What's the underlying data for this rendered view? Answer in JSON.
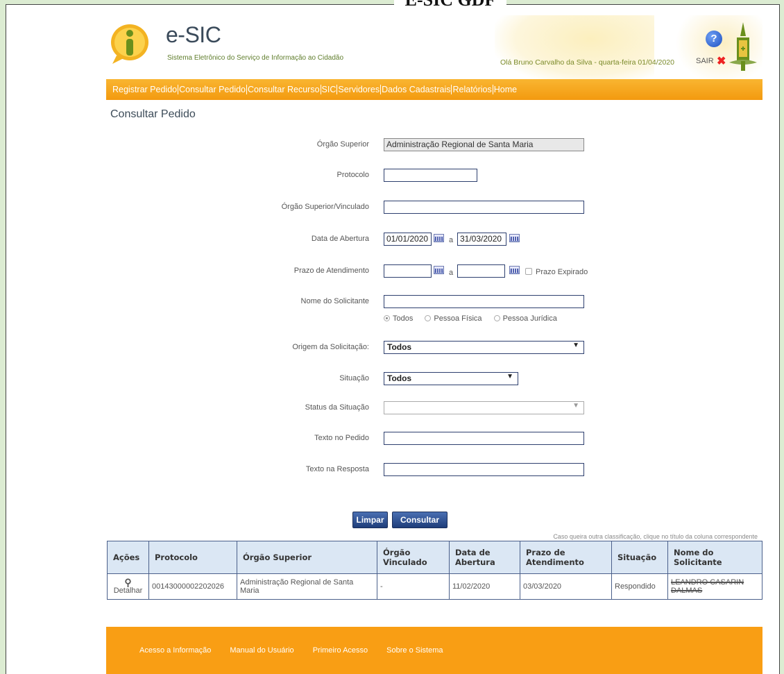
{
  "banner": {
    "title": "E-SIC GDF"
  },
  "header": {
    "logo_title": "e-SIC",
    "logo_subtitle": "Sistema Eletrônico do Serviço de Informação ao Cidadão",
    "greeting": "Olá Bruno Carvalho da Silva - quarta-feira 01/04/2020",
    "logout_label": "SAIR",
    "help_label": "?"
  },
  "menu": {
    "items": [
      "Registrar Pedido",
      "Consultar Pedido",
      "Consultar Recurso",
      "SIC",
      "Servidores",
      "Dados Cadastrais",
      "Relatórios",
      "Home"
    ]
  },
  "page": {
    "title": "Consultar Pedido"
  },
  "form": {
    "orgao_superior": {
      "label": "Órgão Superior",
      "value": "Administração Regional de Santa Maria"
    },
    "protocolo": {
      "label": "Protocolo",
      "value": ""
    },
    "orgao_vinculado": {
      "label": "Órgão Superior/Vinculado",
      "value": ""
    },
    "data_abertura": {
      "label": "Data de Abertura",
      "from": "01/01/2020",
      "to": "31/03/2020",
      "sep": "a"
    },
    "prazo_atendimento": {
      "label": "Prazo de Atendimento",
      "from": "",
      "to": "",
      "sep": "a",
      "expired_label": "Prazo Expirado"
    },
    "nome_solicitante": {
      "label": "Nome do Solicitante",
      "value": "",
      "options": [
        "Todos",
        "Pessoa Física",
        "Pessoa Jurídica"
      ],
      "selected": "Todos"
    },
    "origem": {
      "label": "Origem da Solicitação:",
      "value": "Todos"
    },
    "situacao": {
      "label": "Situação",
      "value": "Todos"
    },
    "status_situacao": {
      "label": "Status da Situação",
      "value": ""
    },
    "texto_pedido": {
      "label": "Texto no Pedido",
      "value": ""
    },
    "texto_resposta": {
      "label": "Texto na Resposta",
      "value": ""
    },
    "btn_limpar": "Limpar",
    "btn_consultar": "Consultar"
  },
  "results": {
    "hint": "Caso queira outra classificação, clique no título da coluna correspondente",
    "columns": [
      "Ações",
      "Protocolo",
      "Órgão Superior",
      "Órgão Vinculado",
      "Data de Abertura",
      "Prazo de Atendimento",
      "Situação",
      "Nome do Solicitante"
    ],
    "rows": [
      {
        "action": "Detalhar",
        "protocolo": "00143000002202026",
        "orgao": "Administração Regional de Santa Maria",
        "vinculado": "-",
        "abertura": "11/02/2020",
        "prazo": "03/03/2020",
        "situacao": "Respondido",
        "nome": "LEANDRO CASARIN DALMAS"
      }
    ]
  },
  "footer": {
    "links": [
      "Acesso a Informação",
      "Manual do Usuário",
      "Primeiro Acesso",
      "Sobre o Sistema"
    ]
  },
  "colors": {
    "menu_orange": "#f39a0f",
    "footer_orange": "#f99e14",
    "button_blue": "#1e3d7a",
    "table_header": "#dbe7f4",
    "page_bg": "#dcecd2"
  }
}
